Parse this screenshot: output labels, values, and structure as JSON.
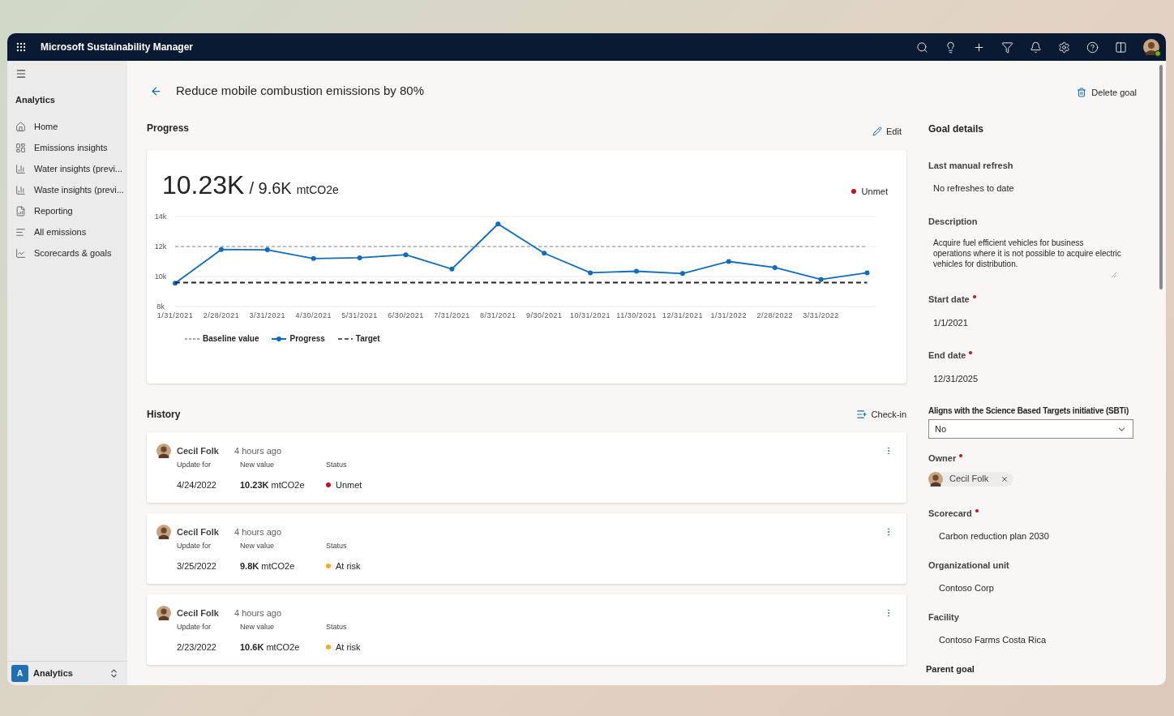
{
  "app": {
    "title": "Microsoft Sustainability Manager"
  },
  "sidebar": {
    "section": "Analytics",
    "items": [
      {
        "label": "Home",
        "kind": "home"
      },
      {
        "label": "Emissions insights",
        "kind": "board"
      },
      {
        "label": "Water insights (previ...",
        "kind": "bars"
      },
      {
        "label": "Waste insights (previ...",
        "kind": "bars"
      },
      {
        "label": "Reporting",
        "kind": "report"
      },
      {
        "label": "All emissions",
        "kind": "list"
      },
      {
        "label": "Scorecards & goals",
        "kind": "trend"
      }
    ],
    "footer": {
      "badge": "A",
      "label": "Analytics"
    }
  },
  "page": {
    "title": "Reduce mobile combustion emissions by 80%",
    "delete": "Delete goal"
  },
  "progress": {
    "heading": "Progress",
    "edit": "Edit",
    "current": "10.23K",
    "target": "/ 9.6K",
    "unit": "mtCO2e",
    "status": {
      "label": "Unmet",
      "color": "#c50f1f"
    },
    "chart_data": {
      "type": "line",
      "categories": [
        "1/31/2021",
        "2/28/2021",
        "3/31/2021",
        "4/30/2021",
        "5/31/2021",
        "6/30/2021",
        "7/31/2021",
        "8/31/2021",
        "9/30/2021",
        "10/31/2021",
        "11/30/2021",
        "12/31/2021",
        "1/31/2022",
        "2/28/2022",
        "3/31/2022",
        null
      ],
      "ylim": [
        8000,
        14000
      ],
      "yticks": [
        {
          "value": 8000,
          "label": "8k"
        },
        {
          "value": 10000,
          "label": "10k"
        },
        {
          "value": 12000,
          "label": "12k"
        },
        {
          "value": 14000,
          "label": "14k"
        }
      ],
      "series": [
        {
          "name": "Baseline value",
          "color": "#8a8a8a",
          "line_style": "dashed",
          "marker": "none",
          "values": [
            12000,
            12000,
            12000,
            12000,
            12000,
            12000,
            12000,
            12000,
            12000,
            12000,
            12000,
            12000,
            12000,
            12000,
            12000,
            12000
          ]
        },
        {
          "name": "Progress",
          "color": "#0f6cbd",
          "line_style": "solid",
          "marker": "circle",
          "values": [
            9550,
            11800,
            11780,
            11200,
            11250,
            11450,
            10500,
            13500,
            11550,
            10250,
            10350,
            10200,
            11000,
            10600,
            9800,
            10250
          ]
        },
        {
          "name": "Target",
          "color": "#242424",
          "line_style": "dashed",
          "marker": "none",
          "values": [
            9600,
            9600,
            9600,
            9600,
            9600,
            9600,
            9600,
            9600,
            9600,
            9600,
            9600,
            9600,
            9600,
            9600,
            9600,
            9600
          ]
        }
      ]
    }
  },
  "history": {
    "heading": "History",
    "checkin": "Check-in",
    "entries": [
      {
        "author": "Cecil Folk",
        "time": "4 hours ago",
        "update_label": "Update for",
        "date": "4/24/2022",
        "value_label": "New value",
        "value": "10.23K",
        "unit": "mtCO2e",
        "status_label": "Status",
        "status": "Unmet",
        "color": "#c50f1f"
      },
      {
        "author": "Cecil Folk",
        "time": "4 hours ago",
        "update_label": "Update for",
        "date": "3/25/2022",
        "value_label": "New value",
        "value": "9.8K",
        "unit": "mtCO2e",
        "status_label": "Status",
        "status": "At risk",
        "color": "#f7a823"
      },
      {
        "author": "Cecil Folk",
        "time": "4 hours ago",
        "update_label": "Update for",
        "date": "2/23/2022",
        "value_label": "New value",
        "value": "10.6K",
        "unit": "mtCO2e",
        "status_label": "Status",
        "status": "At risk",
        "color": "#f7a823"
      }
    ]
  },
  "details": {
    "heading": "Goal details",
    "fields": [
      {
        "kind": "text",
        "label": "Last manual refresh",
        "required": false,
        "value": "No refreshes to date"
      },
      {
        "kind": "textarea",
        "label": "Description",
        "required": false,
        "value": "Acquire fuel efficient vehicles for business operations where it is not possible to acquire electric vehicles for distribution."
      },
      {
        "kind": "text",
        "label": "Start date",
        "required": true,
        "value": "1/1/2021"
      },
      {
        "kind": "text",
        "label": "End date",
        "required": true,
        "value": "12/31/2025"
      },
      {
        "kind": "select",
        "label": "Aligns with the Science Based Targets initiative (SBTi)",
        "required": false,
        "value": "No"
      },
      {
        "kind": "person",
        "label": "Owner",
        "required": true,
        "value": "Cecil Folk"
      },
      {
        "kind": "lookup",
        "label": "Scorecard",
        "required": true,
        "value": "Carbon reduction plan 2030"
      },
      {
        "kind": "lookup",
        "label": "Organizational unit",
        "required": false,
        "value": "Contoso Corp"
      },
      {
        "kind": "lookup",
        "label": "Facility",
        "required": false,
        "value": "Contoso Farms Costa Rica"
      },
      {
        "kind": "heading",
        "label": "Parent goal"
      }
    ]
  }
}
